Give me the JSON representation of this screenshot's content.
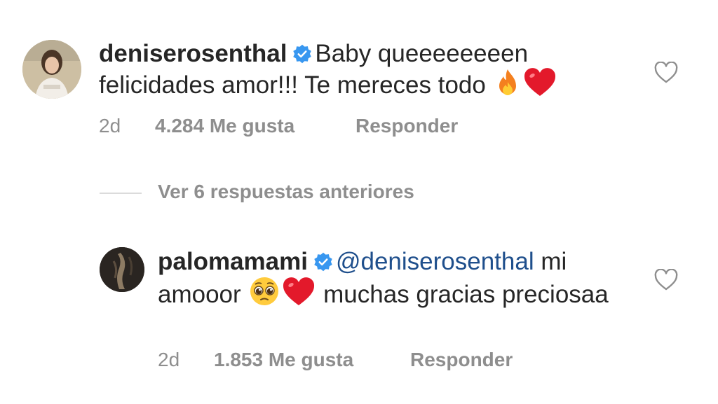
{
  "comments": [
    {
      "username": "deniserosenthal",
      "text_parts": [
        "Baby queeeeeeeen felicidades amor!!! Te mereces todo"
      ],
      "emojis": [
        "fire-emoji",
        "red-heart-emoji"
      ],
      "time": "2d",
      "likes": "4.284 Me gusta",
      "reply_label": "Responder",
      "verified": true,
      "avatar": "profile-photo"
    },
    {
      "username": "palomamami",
      "mention": "@deniserosenthal",
      "text_parts": [
        "mi amooor",
        "muchas gracias preciosaa"
      ],
      "emojis": [
        "pleading-face-emoji",
        "red-heart-emoji"
      ],
      "time": "2d",
      "likes": "1.853 Me gusta",
      "reply_label": "Responder",
      "verified": true,
      "avatar": "profile-photo"
    }
  ],
  "view_replies": "Ver 6 respuestas anteriores",
  "icons": {
    "verified": "verified-badge-icon",
    "like": "heart-outline-icon"
  },
  "colors": {
    "verified": "#3897f0",
    "meta": "#8e8e8e",
    "mention": "#1f4f8c",
    "text": "#262626"
  }
}
